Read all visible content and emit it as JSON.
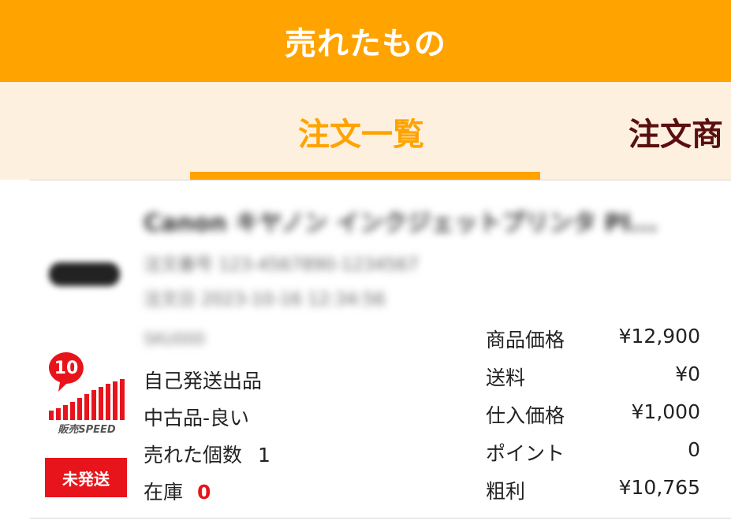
{
  "header": {
    "title": "売れたもの"
  },
  "tabs": [
    {
      "label": "注文一覧",
      "active": true
    },
    {
      "label": "注文商",
      "active": false
    }
  ],
  "order": {
    "product_title": "Canon キヤノン インクジェットプリンタ PI...",
    "meta_line1": "注文番号 123-4567890-1234567",
    "meta_line2": "注文日 2023-10-16 12:34:56",
    "meta_line3": "SKU000",
    "logo_count": "10",
    "logo_text": "販売SPEED",
    "status_badge": "未発送",
    "shipping_method": "自己発送出品",
    "condition": "中古品-良い",
    "sold_count_label": "売れた個数",
    "sold_count": "1",
    "stock_label": "在庫",
    "stock": "0",
    "prices": [
      {
        "label": "商品価格",
        "value": "¥12,900"
      },
      {
        "label": "送料",
        "value": "¥0"
      },
      {
        "label": "仕入価格",
        "value": "¥1,000"
      },
      {
        "label": "ポイント",
        "value": "0"
      },
      {
        "label": "粗利",
        "value": "¥10,765"
      }
    ]
  },
  "colors": {
    "accent": "#ffa300",
    "tab_bg": "#fdf0df",
    "alert": "#e8141b",
    "tab_inactive": "#5a0f0f"
  }
}
